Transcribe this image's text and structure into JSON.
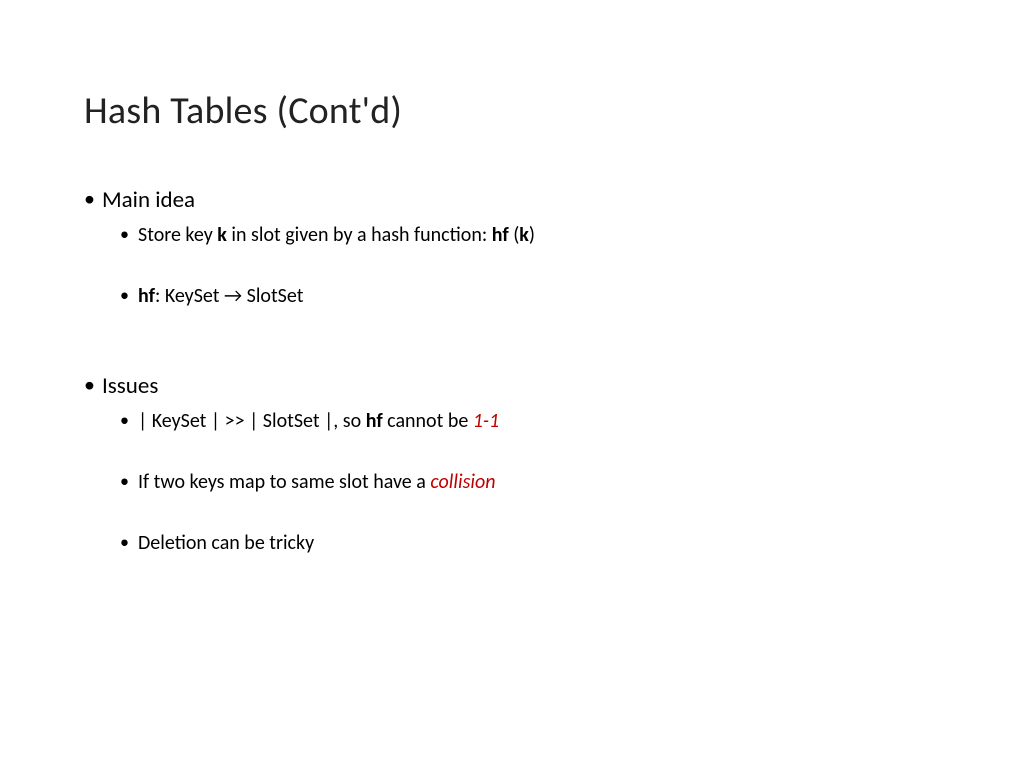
{
  "title": "Hash Tables (Cont'd)",
  "section1": {
    "heading": "Main idea",
    "item1": {
      "t1": "Store key ",
      "k": "k",
      "t2": " in slot given by a hash function: ",
      "hf": "hf",
      "t3": " (",
      "k2": "k",
      "t4": ")"
    },
    "item2": {
      "hf": "hf",
      "t1": ": KeySet ",
      "arrow": "→",
      "t2": " SlotSet"
    }
  },
  "section2": {
    "heading": "Issues",
    "item1": {
      "t1": "| KeySet | >> | SlotSet |, so ",
      "hf": "hf",
      "t2": " cannot be ",
      "red": "1-1"
    },
    "item2": {
      "t1": "If two keys map to same slot have a ",
      "red": "collision"
    },
    "item3": {
      "t1": "Deletion can be tricky"
    }
  }
}
